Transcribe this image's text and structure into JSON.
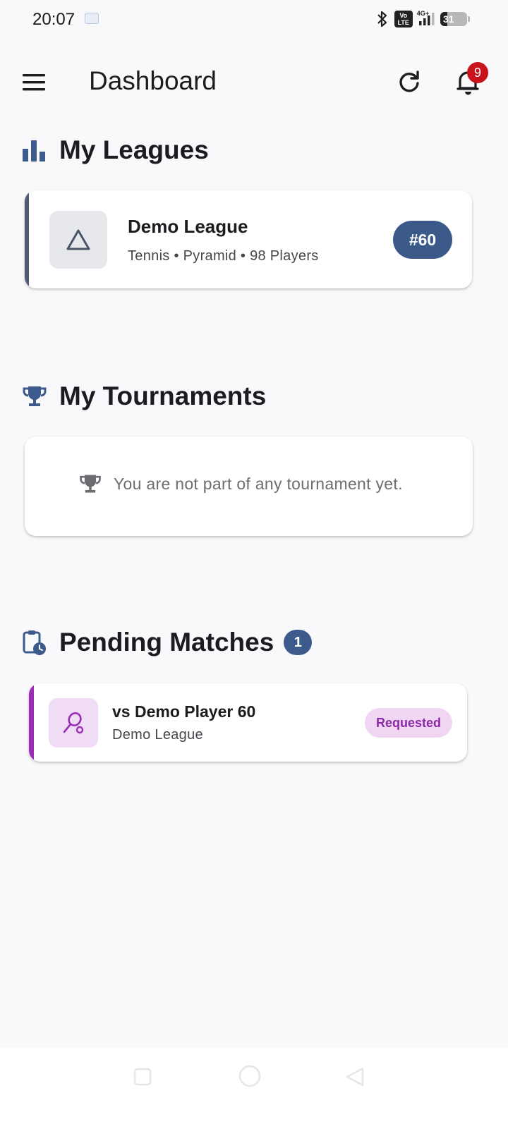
{
  "status_bar": {
    "time": "20:07",
    "volte": "Vo LTE",
    "network": "4G+",
    "battery": "31"
  },
  "app_bar": {
    "title": "Dashboard",
    "notification_count": "9"
  },
  "leagues": {
    "title": "My Leagues",
    "items": [
      {
        "name": "Demo League",
        "meta": "Tennis • Pyramid • 98 Players",
        "rank": "#60",
        "accent_color": "#4e5b73"
      }
    ]
  },
  "tournaments": {
    "title": "My Tournaments",
    "empty_message": "You are not part of any tournament yet."
  },
  "pending_matches": {
    "title": "Pending Matches",
    "count": "1",
    "items": [
      {
        "opponent": "vs Demo Player 60",
        "league": "Demo League",
        "status": "Requested",
        "accent_color": "#9b2cb6"
      }
    ]
  },
  "colors": {
    "primary": "#3b5a8a",
    "background": "#f9f9fb",
    "badge_red": "#c8131c",
    "pending_purple": "#9b2cb6"
  },
  "icons": {
    "menu": "menu-icon",
    "refresh": "refresh-icon",
    "notifications": "bell-icon",
    "leagues": "bar-chart-icon",
    "tournaments": "trophy-icon",
    "pending": "clipboard-clock-icon",
    "league_thumb": "triangle-icon",
    "match_thumb": "tennis-racket-icon"
  }
}
